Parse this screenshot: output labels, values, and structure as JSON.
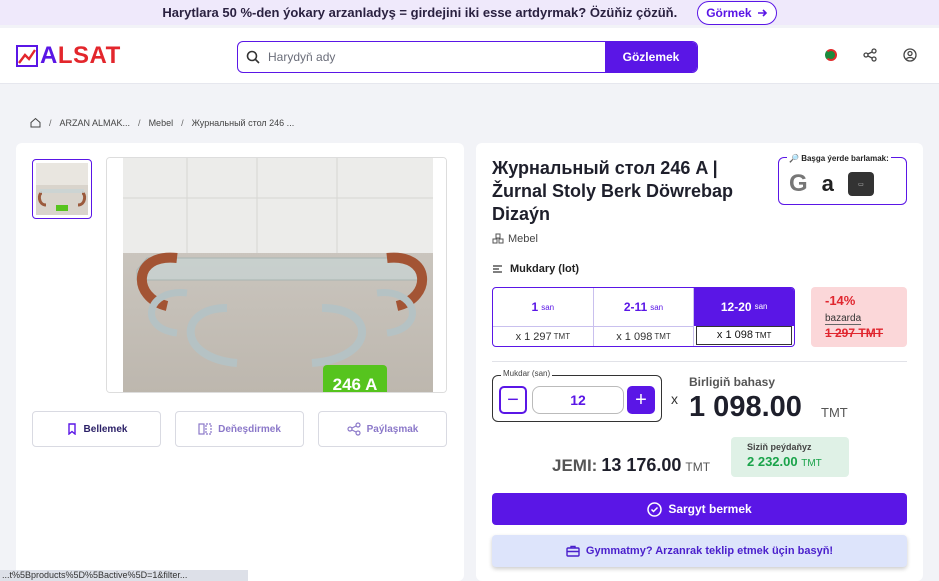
{
  "promo": {
    "text": "Harytlara 50 %-den ýokary arzanladyş = girdejini iki esse artdyrmak? Özüňiz çözüň.",
    "button": "Görmek"
  },
  "header": {
    "brand_a": "A",
    "brand_rest": "LSAT",
    "search_placeholder": "Harydyň ady",
    "search_button": "Gözlemek"
  },
  "breadcrumb": [
    "ARZAN ALMAK...",
    "Mebel",
    "Журнальный стол 246 ..."
  ],
  "gallery": {
    "image_label": "246 A",
    "bookmark": "Bellemek",
    "compare": "Deňeşdirmek",
    "share": "Paýlaşmak"
  },
  "product": {
    "title": "Журнальный стол 246 A | Žurnal Stoly Berk Döwrebap Dizaýn",
    "category": "Mebel",
    "ext_search_title": "Başga ýerde barlamak:",
    "quantity_title": "Mukdary (lot)",
    "tiers": [
      {
        "range": "1",
        "unit": "san",
        "price": "x 1 297",
        "currency": "TMT",
        "active": false
      },
      {
        "range": "2-11",
        "unit": "san",
        "price": "x 1 098",
        "currency": "TMT",
        "active": false
      },
      {
        "range": "12-20",
        "unit": "san",
        "price": "x 1 098",
        "currency": "TMT",
        "active": true
      }
    ],
    "discount": {
      "percent": "-14%",
      "label": "bazarda",
      "old_price": "1 297 TMT"
    },
    "stepper": {
      "label": "Mukdar (san)",
      "value": "12"
    },
    "times": "x",
    "unit_price_label": "Birligiň bahasy",
    "unit_price": "1 098.00",
    "currency": "TMT",
    "total_label": "JEMI:",
    "total_value": "13 176.00",
    "savings_label": "Siziň peýdaňyz",
    "savings_value": "2 232.00",
    "order_button": "Sargyt bermek",
    "offer_button": "Gymmatmy? Arzanrak teklip etmek üçin basyň!"
  },
  "statusbar": "...t%5Bproducts%5D%5Bactive%5D=1&filter...",
  "colors": {
    "accent": "#5a16e6",
    "danger": "#e0262f",
    "success": "#1aa34a"
  }
}
